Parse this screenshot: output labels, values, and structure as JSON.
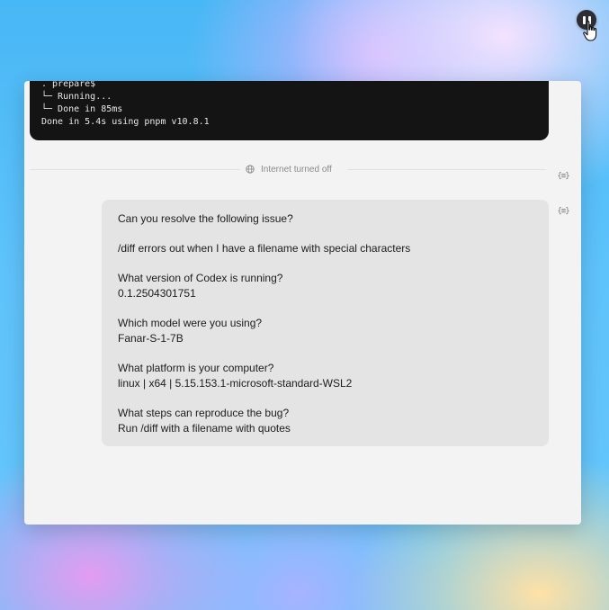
{
  "terminal": {
    "lines": [
      ". prepare$",
      "└─ Running...",
      "└─ Done in 85ms",
      "Done in 5.4s using pnpm v10.8.1"
    ]
  },
  "divider": {
    "label": "Internet turned off",
    "icon": "globe-icon"
  },
  "side_icons": [
    "braces-icon",
    "braces-icon"
  ],
  "message": {
    "lines": [
      "Can you resolve the following issue?",
      "/diff errors out when I have a filename with special characters",
      "What version of Codex is running?",
      "0.1.2504301751",
      "Which model were you using?",
      "Fanar-S-1-7B",
      "What platform is your computer?",
      "linux | x64 | 5.15.153.1-microsoft-standard-WSL2",
      "What steps can reproduce the bug?",
      "Run /diff with a filename with quotes"
    ]
  },
  "colors": {
    "terminal_bg": "#141414",
    "window_bg": "#f3f3f3",
    "bubble_bg": "#e4e4e4"
  }
}
